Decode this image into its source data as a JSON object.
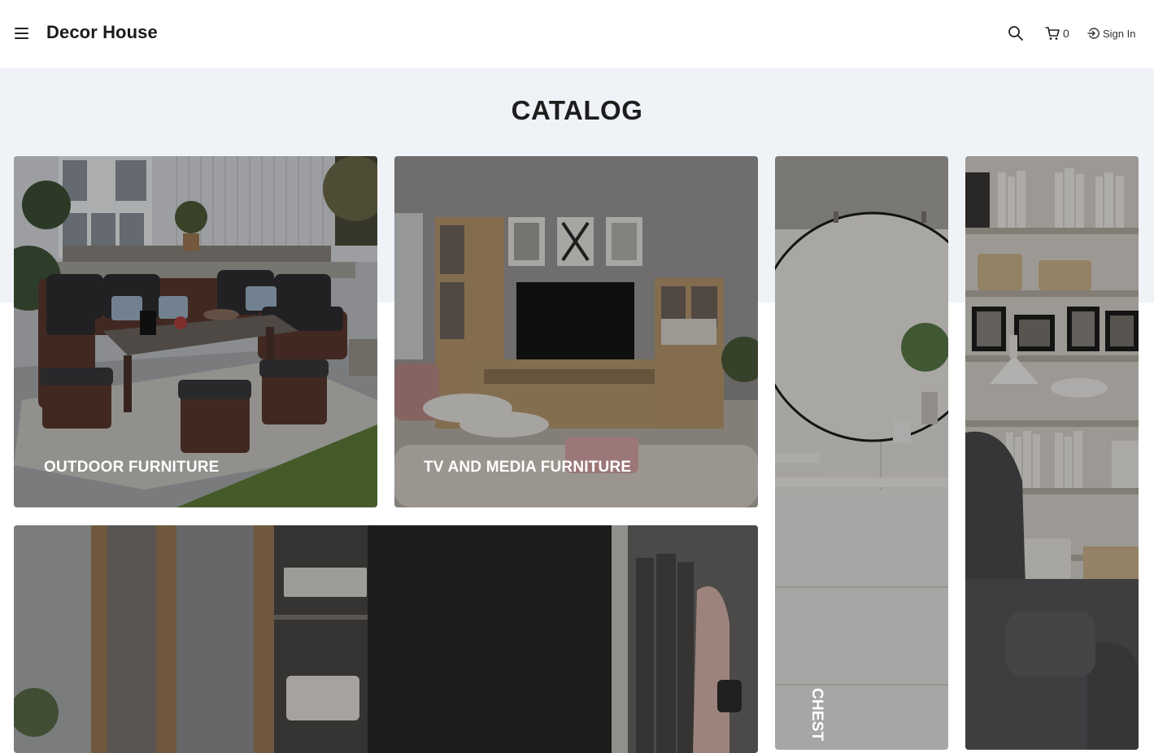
{
  "header": {
    "brand": "Decor House",
    "cart_count": "0",
    "signin_label": "Sign In",
    "icons": {
      "menu": "hamburger-menu-icon",
      "search": "search-icon",
      "cart": "cart-icon",
      "signin": "sign-in-icon"
    }
  },
  "catalog": {
    "title": "CATALOG",
    "cards": [
      {
        "label": "OUTDOOR FURNITURE"
      },
      {
        "label": "TV AND MEDIA FURNITURE"
      },
      {
        "label": "CHEST"
      },
      {
        "label": ""
      },
      {
        "label": ""
      }
    ]
  },
  "colors": {
    "band_background": "#eff2f7",
    "text_primary": "#1d1d1d",
    "card_label": "#ffffff"
  }
}
